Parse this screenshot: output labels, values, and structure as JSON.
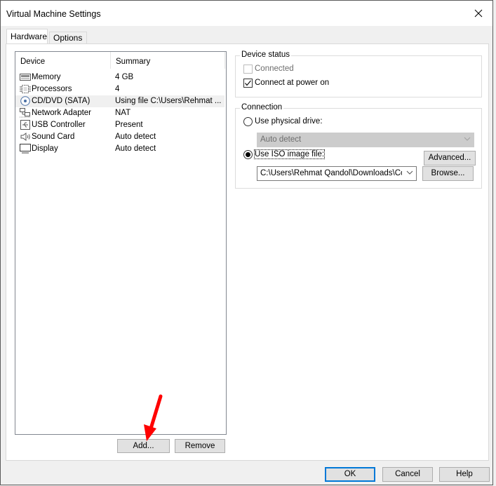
{
  "window": {
    "title": "Virtual Machine Settings",
    "close_icon": "close-icon"
  },
  "tabs": [
    {
      "label": "Hardware",
      "active": true
    },
    {
      "label": "Options",
      "active": false
    }
  ],
  "device_list": {
    "columns": [
      "Device",
      "Summary"
    ],
    "rows": [
      {
        "icon": "memory-icon",
        "device": "Memory",
        "summary": "4 GB",
        "selected": false
      },
      {
        "icon": "processor-icon",
        "device": "Processors",
        "summary": "4",
        "selected": false
      },
      {
        "icon": "cd-dvd-icon",
        "device": "CD/DVD (SATA)",
        "summary": "Using file C:\\Users\\Rehmat ...",
        "selected": true
      },
      {
        "icon": "network-adapter-icon",
        "device": "Network Adapter",
        "summary": "NAT",
        "selected": false
      },
      {
        "icon": "usb-icon",
        "device": "USB Controller",
        "summary": "Present",
        "selected": false
      },
      {
        "icon": "sound-icon",
        "device": "Sound Card",
        "summary": "Auto detect",
        "selected": false
      },
      {
        "icon": "display-icon",
        "device": "Display",
        "summary": "Auto detect",
        "selected": false
      }
    ],
    "add_label": "Add...",
    "remove_label": "Remove"
  },
  "device_status": {
    "title": "Device status",
    "connected": {
      "label": "Connected",
      "checked": false,
      "enabled": false
    },
    "connect_at_power_on": {
      "label": "Connect at power on",
      "checked": true,
      "enabled": true
    }
  },
  "connection": {
    "title": "Connection",
    "physical_drive": {
      "label": "Use physical drive:",
      "selected": false,
      "value": "Auto detect"
    },
    "iso_image": {
      "label": "Use ISO image file:",
      "selected": true,
      "value": "C:\\Users\\Rehmat Qandol\\Downloads\\Comp"
    },
    "browse_label": "Browse..."
  },
  "advanced_label": "Advanced...",
  "footer": {
    "ok_label": "OK",
    "cancel_label": "Cancel",
    "help_label": "Help"
  },
  "annotation": {
    "type": "red-arrow",
    "points_to": "Add..."
  }
}
